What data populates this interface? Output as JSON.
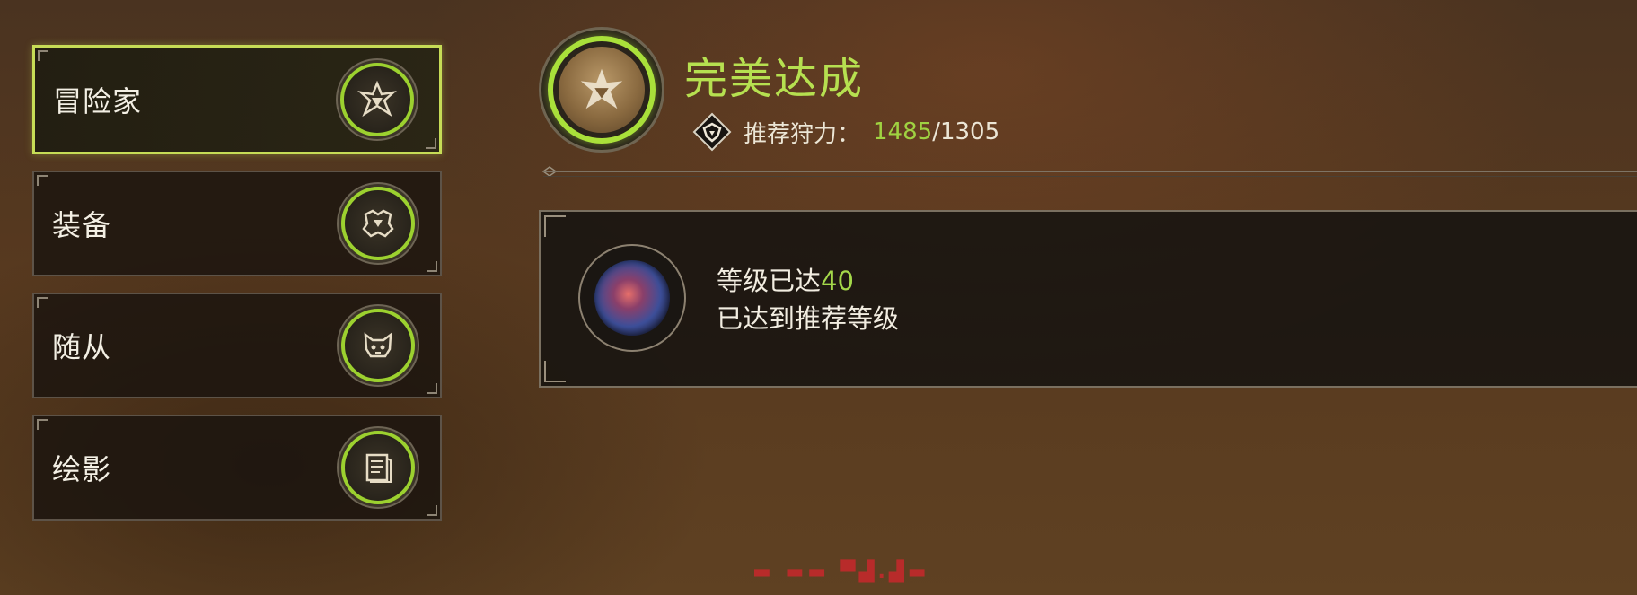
{
  "sidebar": {
    "items": [
      {
        "label": "冒险家",
        "icon": "adventurer-icon",
        "active": true
      },
      {
        "label": "装备",
        "icon": "armor-icon",
        "active": false
      },
      {
        "label": "随从",
        "icon": "companion-icon",
        "active": false
      },
      {
        "label": "绘影",
        "icon": "scroll-icon",
        "active": false
      }
    ]
  },
  "header": {
    "title": "完美达成",
    "power_label": "推荐狩力：",
    "power_current": "1485",
    "power_separator": "/",
    "power_recommended": "1305"
  },
  "requirement": {
    "line1_prefix": "等级已达",
    "line1_value": "40",
    "line2": "已达到推荐等级"
  },
  "colors": {
    "accent_green": "#b6e050",
    "ring_green": "#9cd12f",
    "panel_bg": "#181511",
    "watermark_red": "#c8282c"
  }
}
